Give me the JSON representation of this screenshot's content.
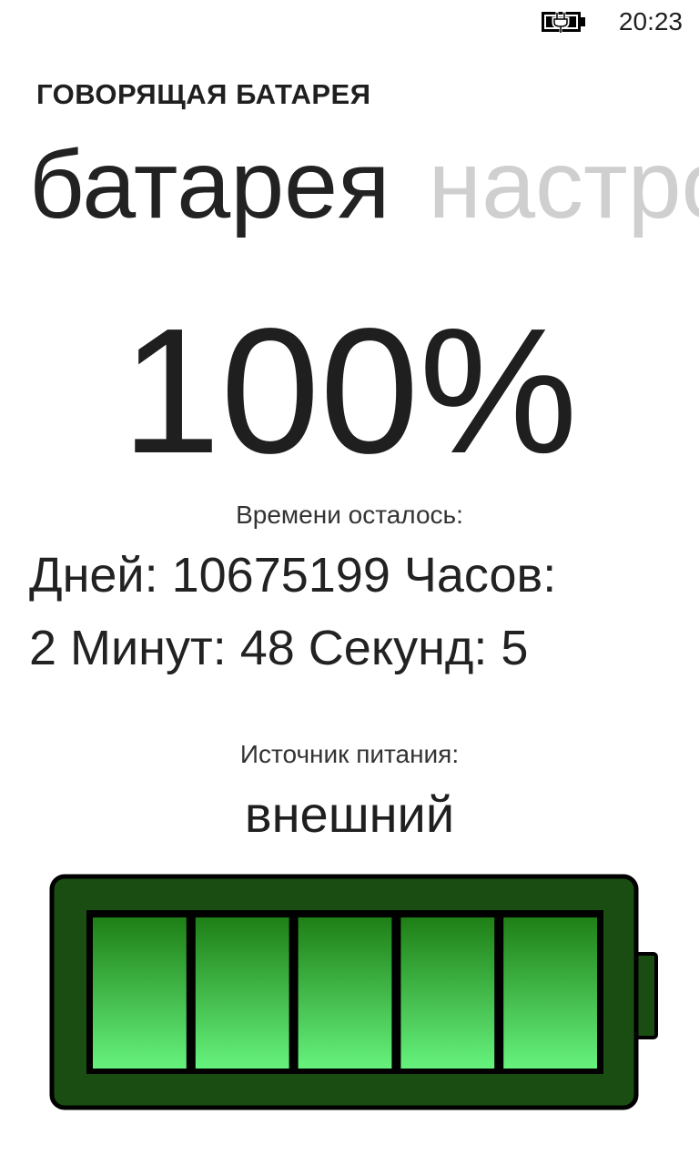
{
  "status_bar": {
    "time": "20:23",
    "icon": "battery-charging-icon"
  },
  "app": {
    "title": "ГОВОРЯЩАЯ БАТАРЕЯ"
  },
  "pivot": {
    "tabs": [
      {
        "label": "батарея",
        "active": true
      },
      {
        "label": "настройки",
        "active": false
      }
    ]
  },
  "battery": {
    "percent_text": "100%",
    "percent": 100,
    "time_label": "Времени осталось:",
    "time_value_line1": "Дней: 10675199 Часов:",
    "time_value_line2": "2 Минут: 48 Секунд: 5",
    "source_label": "Источник питания:",
    "source_value": "внешний",
    "segments_total": 5,
    "segments_filled": 5
  },
  "colors": {
    "battery_outer": "#1a4d12",
    "battery_frame": "#0b3a07",
    "segment_top": "#1e7f16",
    "segment_bottom": "#66f27d",
    "inactive_tab": "#cfcfcf"
  }
}
